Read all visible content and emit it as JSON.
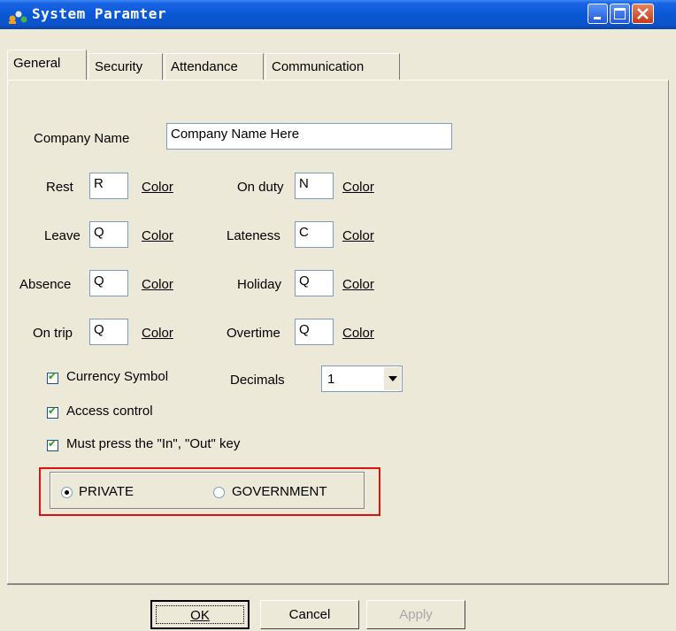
{
  "window": {
    "title": "System Paramter"
  },
  "tabs": [
    {
      "label": "General"
    },
    {
      "label": "Security"
    },
    {
      "label": "Attendance"
    },
    {
      "label": "Communication"
    }
  ],
  "company": {
    "label": "Company Name",
    "value": "Company Name Here"
  },
  "codes": [
    {
      "label": "Rest",
      "value": "R",
      "color_label": "Color"
    },
    {
      "label": "On duty",
      "value": "N",
      "color_label": "Color"
    },
    {
      "label": "Leave",
      "value": "Q",
      "color_label": "Color"
    },
    {
      "label": "Lateness",
      "value": "C",
      "color_label": "Color"
    },
    {
      "label": "Absence",
      "value": "Q",
      "color_label": "Color"
    },
    {
      "label": "Holiday",
      "value": "Q",
      "color_label": "Color"
    },
    {
      "label": "On trip",
      "value": "Q",
      "color_label": "Color"
    },
    {
      "label": "Overtime",
      "value": "Q",
      "color_label": "Color"
    }
  ],
  "options": {
    "currency_symbol": {
      "label": "Currency Symbol",
      "checked": true
    },
    "access_control": {
      "label": "Access control",
      "checked": true
    },
    "must_press": {
      "label": "Must press the \"In\", \"Out\" key",
      "checked": true
    }
  },
  "decimals": {
    "label": "Decimals",
    "value": "1"
  },
  "mode": {
    "private_label": "PRIVATE",
    "government_label": "GOVERNMENT",
    "selected": "PRIVATE"
  },
  "buttons": {
    "ok": "OK",
    "cancel": "Cancel",
    "apply": "Apply"
  },
  "colors": {
    "titlebar": "#0a58d6",
    "highlight": "#e01010",
    "background": "#ece9d8"
  }
}
